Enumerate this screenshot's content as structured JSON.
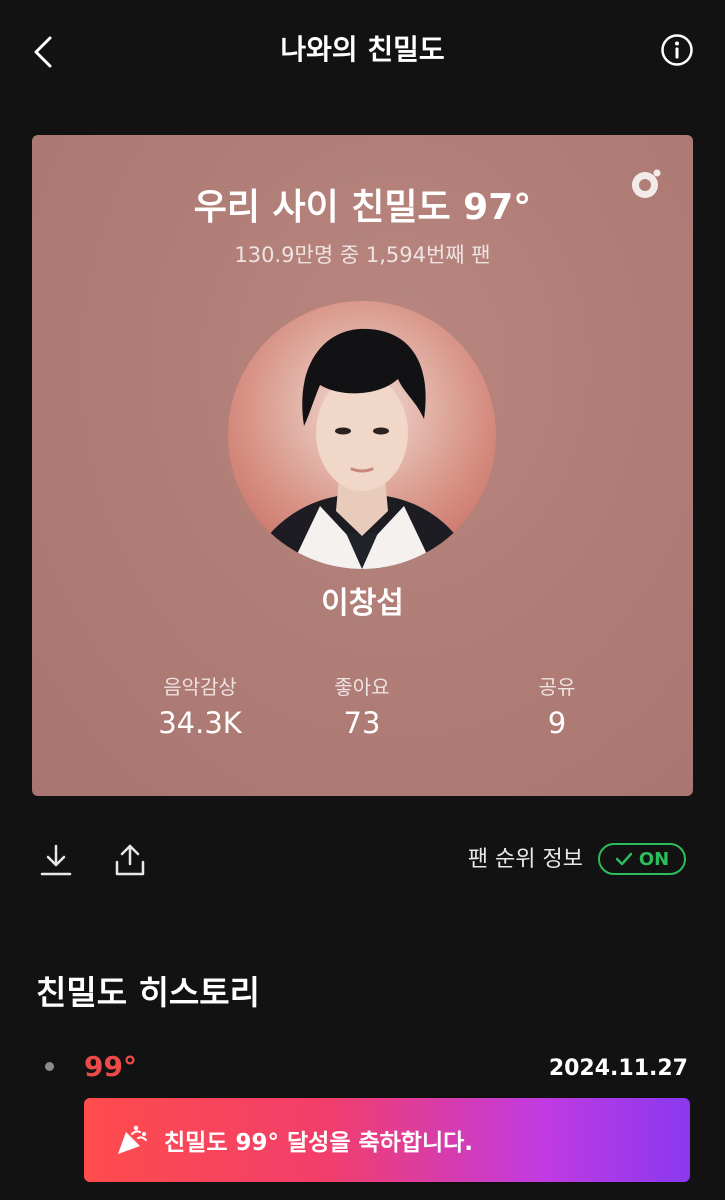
{
  "header": {
    "title": "나와의 친밀도",
    "back_icon": "chevron-left-icon",
    "info_icon": "info-circle-icon"
  },
  "card": {
    "title": "우리 사이 친밀도 97°",
    "subtitle": "130.9만명 중 1,594번째 팬",
    "artist_name": "이창섭",
    "avatar_description": "artist-profile-photo",
    "logo_icon": "melon-logo-icon",
    "background_color": "#b07d77",
    "stats": [
      {
        "label": "음악감상",
        "value": "34.3K"
      },
      {
        "label": "좋아요",
        "value": "73"
      },
      {
        "label": "공유",
        "value": "9"
      }
    ]
  },
  "actions": {
    "download_icon": "download-icon",
    "share_icon": "share-icon",
    "rank_info_label": "팬 순위 정보",
    "toggle_label": "ON",
    "toggle_state": true,
    "toggle_color": "#2dbd5a"
  },
  "history": {
    "title": "친밀도 히스토리",
    "items": [
      {
        "temperature": "99°",
        "date": "2024.11.27",
        "message": "친밀도 99° 달성을 축하합니다.",
        "temperature_color": "#ef4a4a"
      }
    ]
  }
}
